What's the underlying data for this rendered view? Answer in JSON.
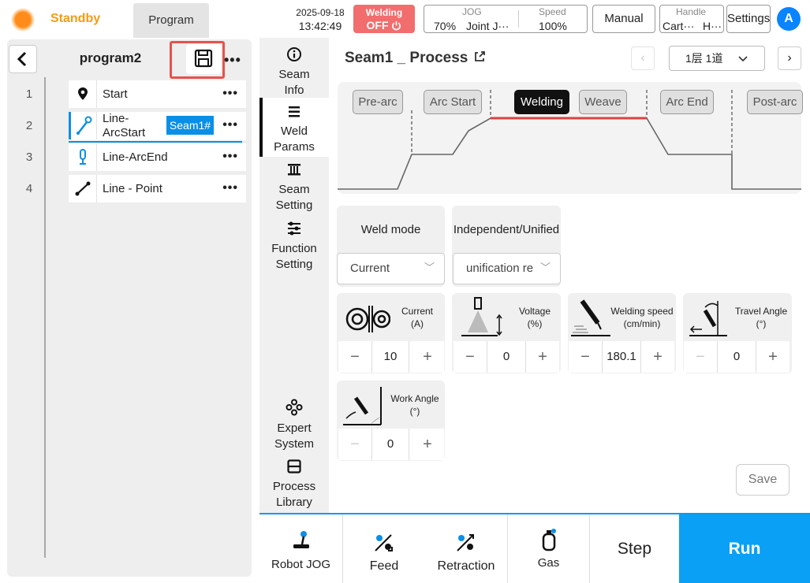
{
  "header": {
    "status": "Standby",
    "program_tab": "Program",
    "date": "2025-09-18",
    "time": "13:42:49",
    "welding_label": "Welding",
    "welding_state": "OFF",
    "jog_label": "JOG",
    "jog_percent": "70%",
    "jog_mode": "Joint J···",
    "speed_label": "Speed",
    "speed_value": "100%",
    "mode_button": "Manual",
    "handle_label": "Handle",
    "handle_value1": "Cart···",
    "handle_value2": "H···",
    "settings": "Settings",
    "avatar": "A"
  },
  "program": {
    "name": "program2",
    "rows": [
      {
        "num": "1",
        "label": "Start"
      },
      {
        "num": "2",
        "label": "Line-\nArcStart",
        "tag": "Seam1#"
      },
      {
        "num": "3",
        "label": "Line-ArcEnd"
      },
      {
        "num": "4",
        "label": "Line - Point"
      }
    ]
  },
  "nav": {
    "seam_info": "Seam\nInfo",
    "weld_params": "Weld\nParams",
    "seam_setting": "Seam\nSetting",
    "function_setting": "Function\nSetting",
    "expert_system": "Expert\nSystem",
    "process_library": "Process\nLibrary"
  },
  "main": {
    "title": "Seam1 _ Process",
    "layer_select": "1层  1道",
    "phases": [
      "Pre-arc",
      "Arc Start",
      "Welding",
      "Weave",
      "Arc End",
      "Post-arc"
    ],
    "active_phase": "Welding",
    "weld_mode_label": "Weld mode",
    "weld_mode_value": "Current",
    "indep_label": "Independent/Unified",
    "indep_value": "unification re",
    "params": [
      {
        "label": "Current\n(A)",
        "value": "10"
      },
      {
        "label": "Voltage\n(%)",
        "value": "0"
      },
      {
        "label": "Welding speed\n(cm/min)",
        "value": "180.1"
      },
      {
        "label": "Travel Angle\n(°)",
        "value": "0"
      },
      {
        "label": "Work Angle\n(°)",
        "value": "0"
      }
    ],
    "save": "Save"
  },
  "bottom": {
    "robot_jog": "Robot JOG",
    "feed": "Feed",
    "retraction": "Retraction",
    "gas": "Gas",
    "step": "Step",
    "run": "Run"
  },
  "colors": {
    "accent_blue": "#0aa0f5",
    "welding_off_red": "#f26d6d",
    "standby_orange": "#f39c12",
    "highlight_red": "#e5534b"
  }
}
